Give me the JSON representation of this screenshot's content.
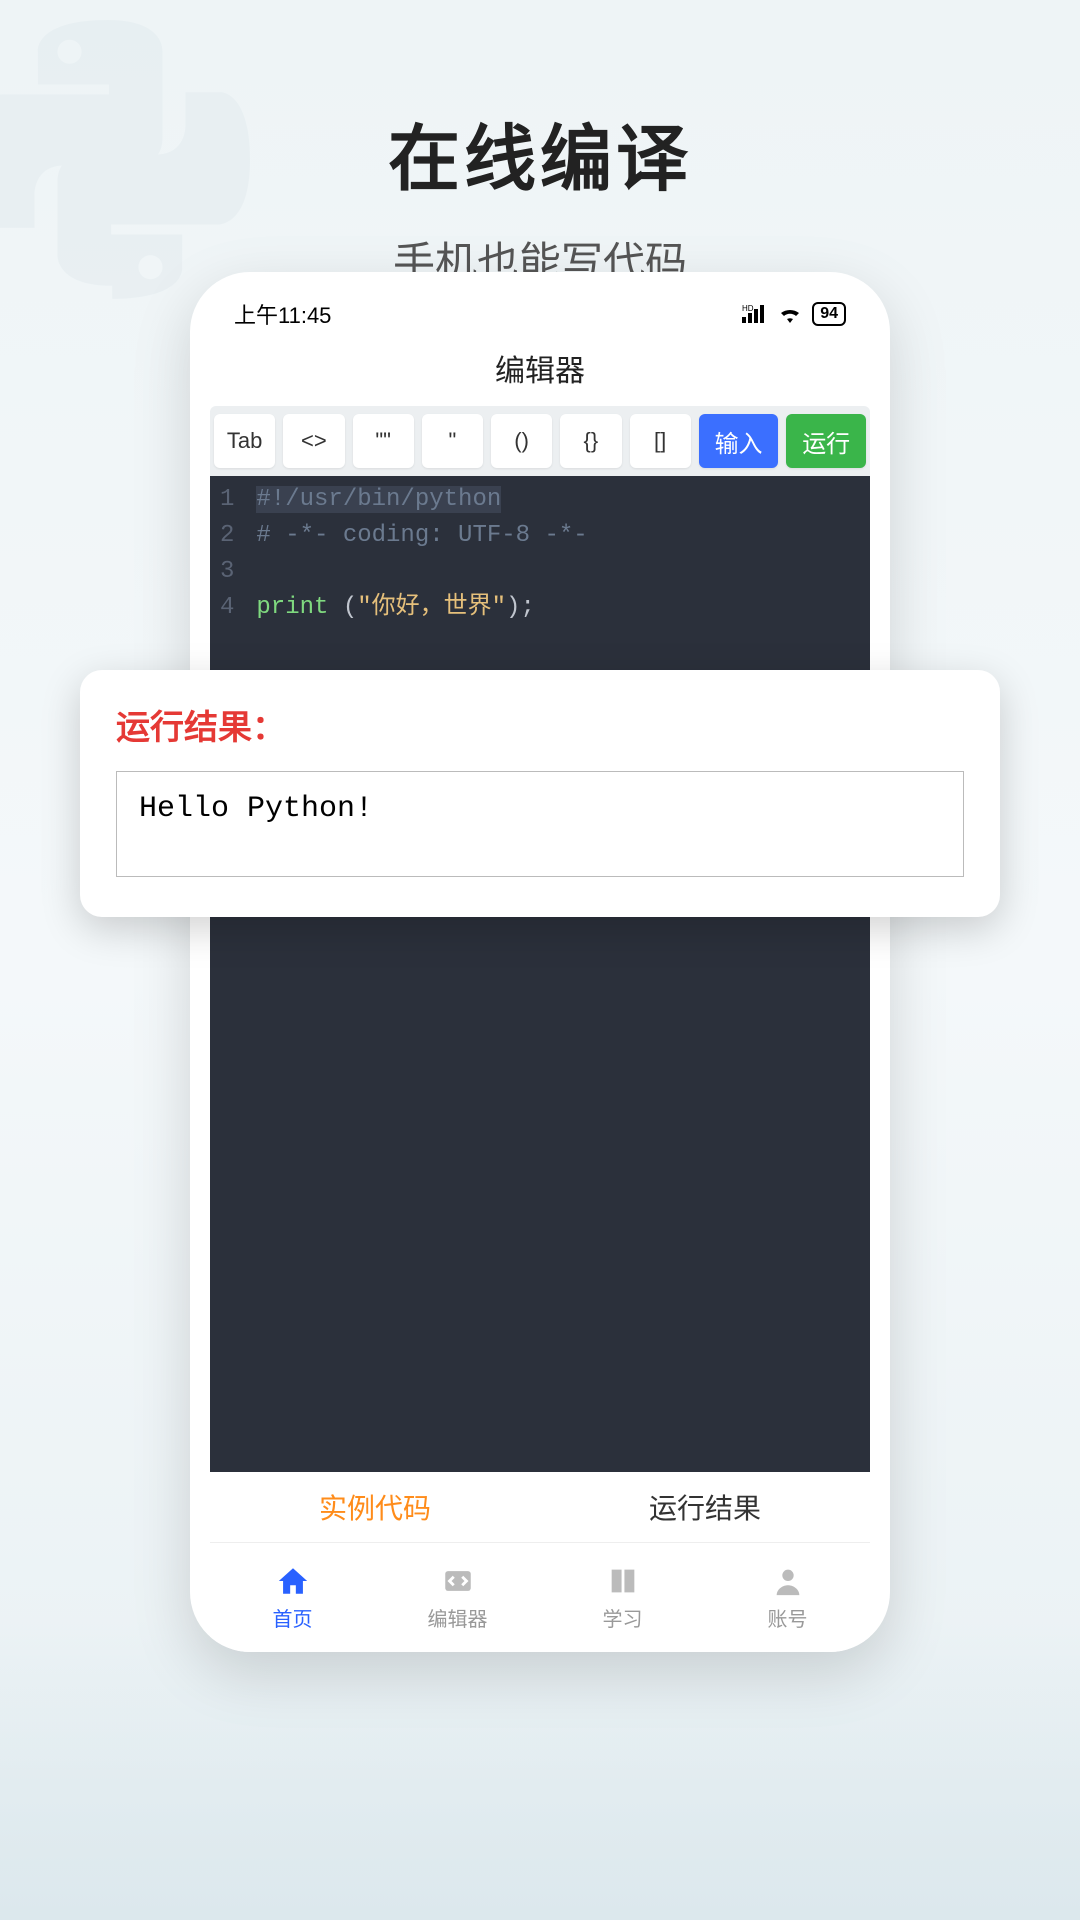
{
  "headline": {
    "title": "在线编译",
    "subtitle": "手机也能写代码"
  },
  "statusBar": {
    "time": "上午11:45",
    "battery": "94"
  },
  "appTitle": "编辑器",
  "toolbar": {
    "tab": "Tab",
    "angle": "<>",
    "dquote": "\"\"",
    "squote": "\"",
    "paren": "()",
    "brace": "{}",
    "bracket": "[]",
    "input": "输入",
    "run": "运行"
  },
  "code": {
    "line1": "#!/usr/bin/python",
    "line2": "# -*- coding: UTF-8 -*-",
    "line4_fn": "print",
    "line4_str": "\"你好，世界\"",
    "lineNumbers": [
      "1",
      "2",
      "3",
      "4"
    ]
  },
  "result": {
    "label": "运行结果：",
    "output": "Hello Python!"
  },
  "subTabs": {
    "example": "实例代码",
    "result": "运行结果"
  },
  "bottomNav": {
    "home": "首页",
    "editor": "编辑器",
    "learn": "学习",
    "account": "账号"
  }
}
